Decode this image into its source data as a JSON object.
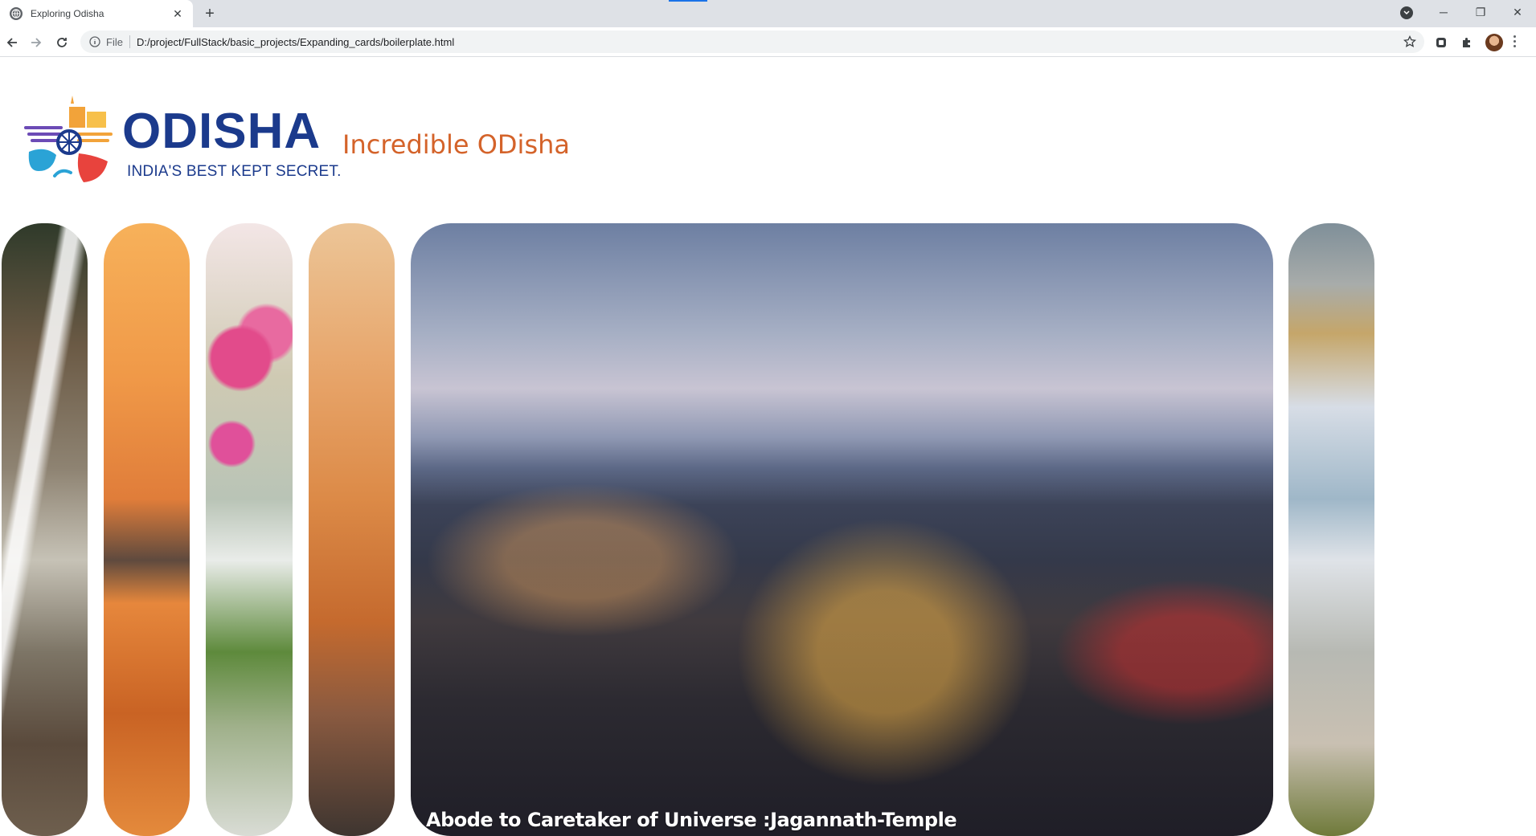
{
  "browser": {
    "tab_title": "Exploring Odisha",
    "new_tab_symbol": "+",
    "scheme_label": "File",
    "url": "D:/project/FullStack/basic_projects/Expanding_cards/boilerplate.html",
    "icons": [
      "globe-icon",
      "close-icon",
      "back-arrow-icon",
      "forward-arrow-icon",
      "reload-icon",
      "info-icon",
      "star-icon",
      "extension-icon",
      "puzzle-icon",
      "avatar",
      "menu-icon",
      "tab-search-icon",
      "minimize-icon",
      "restore-icon",
      "close-window-icon"
    ]
  },
  "page": {
    "logo_word": "ODISHA",
    "logo_tagline": "INDIA'S BEST KEPT SECRET.",
    "heading": "Incredible ODisha",
    "active_caption": "Abode to Caretaker of Universe :Jagannath-Temple",
    "colors": {
      "heading": "#d4632a",
      "logo_text": "#1b3a8c",
      "caption": "#ffffff"
    }
  }
}
